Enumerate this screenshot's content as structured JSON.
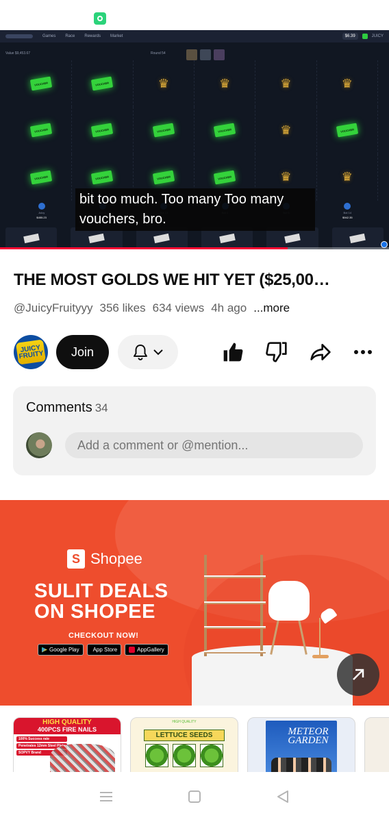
{
  "video": {
    "subtitle": "bit too much. Too many Too many vouchers, bro.",
    "progress": 0.74,
    "embedded": {
      "nav": [
        "Games",
        "Race",
        "Rewards",
        "Market"
      ],
      "balance": "$6.39",
      "user": "JUICY",
      "value_label": "Value $9,453.67",
      "round_label": "Round 54",
      "voucher_text": "VOUCHER",
      "players": [
        {
          "name": "Juicy",
          "amount": "$455.23"
        },
        {
          "name": "Bot 4",
          "amount": ""
        },
        {
          "name": "Bot 13",
          "amount": ""
        },
        {
          "name": "Bot 2",
          "amount": ""
        },
        {
          "name": "Bot 6",
          "amount": ""
        },
        {
          "name": "Bot 14",
          "amount": "$942.35"
        }
      ]
    }
  },
  "title": "THE MOST GOLDS WE HIT YET ($25,00…",
  "meta": {
    "channel": "@JuicyFruityyy",
    "likes": "356 likes",
    "views": "634 views",
    "age": "4h ago",
    "more": "...more"
  },
  "actions": {
    "avatar_text": "JUICY FRUITY",
    "join": "Join"
  },
  "comments": {
    "label": "Comments",
    "count": "34",
    "placeholder": "Add a comment or @mention..."
  },
  "ad": {
    "brand": "Shopee",
    "headline_line1": "SULIT DEALS",
    "headline_line2": "ON SHOPEE",
    "cta": "CHECKOUT NOW!",
    "stores": [
      "Google Play",
      "App Store",
      "AppGallery"
    ],
    "brand_color": "#ee4d2d"
  },
  "products": [
    {
      "top": "HIGH QUALITY",
      "title": "400PCS FIRE NAILS",
      "bullets": [
        "100% Success rate",
        "Penetrates 12mm Steel Plate",
        "SOPVY Brand"
      ]
    },
    {
      "top": "HIGH QUALITY",
      "title": "LETTUCE SEEDS"
    },
    {
      "title": "METEOR GARDEN"
    },
    {
      "title": ""
    }
  ],
  "navbar": {
    "icons": [
      "menu-icon",
      "home-square-icon",
      "back-triangle-icon"
    ]
  }
}
